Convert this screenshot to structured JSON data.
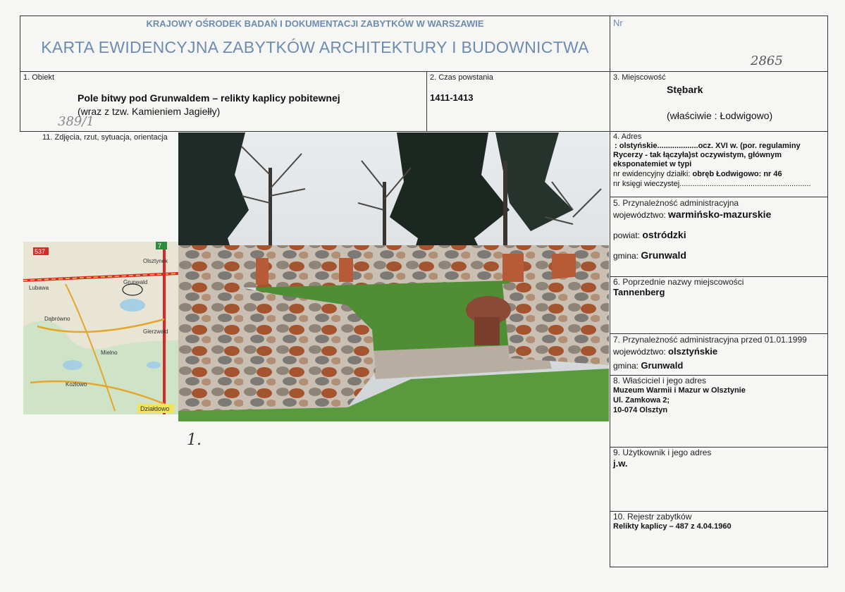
{
  "header": {
    "institution": "KRAJOWY OŚRODEK BADAŃ I DOKUMENTACJI ZABYTKÓW W WARSZAWIE",
    "card_title": "KARTA EWIDENCYJNA ZABYTKÓW ARCHITEKTURY I BUDOWNICTWA",
    "nr_label": "Nr",
    "nr_value": "2865"
  },
  "f1": {
    "label": "1. Obiekt",
    "name": "Pole bitwy pod Grunwaldem – relikty kaplicy pobitewnej",
    "sub": "(wraz z tzw. Kamieniem Jagiełły)",
    "handnote": "389/1"
  },
  "f2": {
    "label": "2. Czas powstania",
    "value": "1411-1413"
  },
  "f3": {
    "label": "3. Miejscowość",
    "value": "Stębark",
    "owner": "(właściwie : Łodwigowo)"
  },
  "f4": {
    "label": "4. Adres",
    "line1": ": olstyńskie...................ocz. XVI w. (por. regulaminy",
    "line2": "Rycerzy - tak  łączyła)st oczywistym, głównym",
    "line3": "eksponatemiet w typi",
    "parcel_label": "nr ewidencyjny działki:",
    "parcel_value": "obręb Łodwigowo: nr 46",
    "kw_label": "nr księgi wieczystej",
    "kw_dots": "............................................................."
  },
  "f5": {
    "label": "5. Przynależność administracyjna",
    "woj_label": "województwo:",
    "woj_value": "warmińsko-mazurskie",
    "pow_label": "powiat:",
    "pow_value": "ostródzki",
    "gm_label": "gmina:",
    "gm_value": "Grunwald"
  },
  "f6": {
    "label": "6. Poprzednie nazwy miejscowości",
    "value": "Tannenberg"
  },
  "f7": {
    "label": "7. Przynależność administracyjna przed 01.01.1999",
    "woj_label": "województwo:",
    "woj_value": "olsztyńskie",
    "gm_label": "gmina:",
    "gm_value": "Grunwald"
  },
  "f8": {
    "label": "8. Właściciel i jego adres",
    "l1": "Muzeum Warmii i Mazur w Olsztynie",
    "l2": "Ul. Zamkowa 2;",
    "l3": "10-074 Olsztyn"
  },
  "f9": {
    "label": "9. Użytkownik i jego adres",
    "value": "j.w."
  },
  "f10": {
    "label": "10. Rejestr zabytków",
    "value": "Relikty kaplicy – 487 z 4.04.1960"
  },
  "f11": {
    "label": "11.  Zdjęcia, rzut, sytuacja, orientacja",
    "photo_num": "1."
  },
  "map": {
    "labels": [
      "Lubawa",
      "Grunwald",
      "Olsztynek",
      "Dąbrówno",
      "Mielno",
      "Gierzwałd",
      "Kozłowo",
      "Działdowo"
    ],
    "roads": [
      "537",
      "7"
    ]
  }
}
